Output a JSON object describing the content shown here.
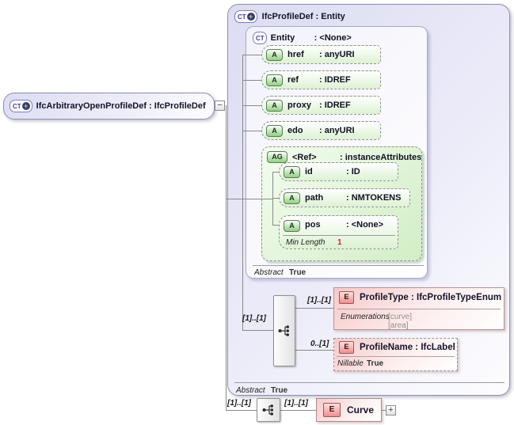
{
  "colors": {
    "complex_type_fill": "#e3e3f6",
    "attribute_fill": "#ddf2d3",
    "element_fill": "#f7caca",
    "connector": "#8a8a8a",
    "facet_red": "#d42222"
  },
  "icons": {
    "complex_type": "CT",
    "complex_type_plus": "+",
    "attribute": "A",
    "attribute_group": "AG",
    "element": "E",
    "collapse": "−",
    "expand": "+"
  },
  "root_element": {
    "title": "IfcArbitraryOpenProfileDef : IfcProfileDef"
  },
  "type_box": {
    "title": "IfcProfileDef : Entity",
    "abstract": {
      "label": "Abstract",
      "value": "True"
    },
    "entity_box": {
      "name": "Entity",
      "type": ": <None>",
      "abstract": {
        "label": "Abstract",
        "value": "True"
      },
      "attributes": [
        {
          "name": "href",
          "type": ": anyURI"
        },
        {
          "name": "ref",
          "type": ": IDREF"
        },
        {
          "name": "proxy",
          "type": ": IDREF"
        },
        {
          "name": "edo",
          "type": ": anyURI"
        }
      ],
      "attribute_group": {
        "name": "<Ref>",
        "type": ": instanceAttributes",
        "attributes": [
          {
            "name": "id",
            "type": ": ID"
          },
          {
            "name": "path",
            "type": ": NMTOKENS"
          },
          {
            "name": "pos",
            "type": ": <None>",
            "facet_label": "Min Length",
            "facet_value": "1"
          }
        ]
      }
    },
    "sequence": {
      "cardinality": "[1]..[1]",
      "children": [
        {
          "cardinality": "[1]..[1]",
          "title": "ProfileType : IfcProfileTypeEnum",
          "facet_label": "Enumerations",
          "facet_values": [
            "[curve]",
            "[area]"
          ]
        },
        {
          "cardinality": "0..[1]",
          "title": "ProfileName : IfcLabel",
          "facet_label": "Nillable",
          "facet_value": "True"
        }
      ]
    }
  },
  "extension": {
    "sequence_cardinality": "[1]..[1]",
    "element": {
      "cardinality": "[1]..[1]",
      "title": "Curve"
    }
  }
}
